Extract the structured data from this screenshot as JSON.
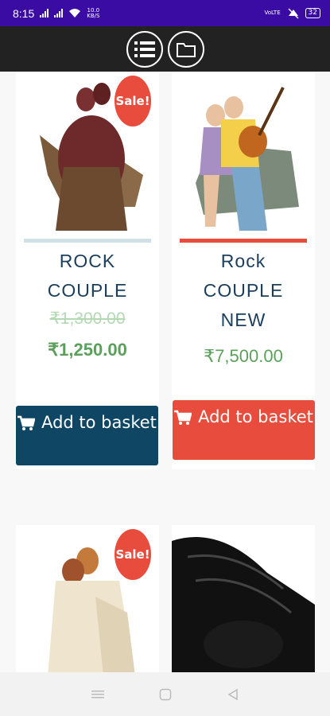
{
  "status_bar": {
    "time": "8:15",
    "speed": "10.0",
    "speed_unit": "KB/S",
    "volte": "VoLTE",
    "battery": "32"
  },
  "header": {
    "list_icon": "list-icon",
    "folder_icon": "folder-icon"
  },
  "products": [
    {
      "title": "ROCK COUPLE",
      "sale_badge": "Sale!",
      "old_price": "₹1,300.00",
      "price": "₹1,250.00",
      "button_label": "Add to basket"
    },
    {
      "title": "Rock COUPLE NEW",
      "price": "₹7,500.00",
      "button_label": "Add to basket"
    },
    {
      "sale_badge": "Sale!"
    },
    {}
  ],
  "nav_bar": {
    "menu_icon": "menu-icon",
    "home_icon": "home-icon",
    "back_icon": "back-icon"
  },
  "colors": {
    "status_bar": "#3a0ca3",
    "header": "#222222",
    "sale": "#e74c3c",
    "button_dark": "#0e4663",
    "button_red": "#e74c3c",
    "price": "#5aa05a",
    "title": "#1a3e5c"
  }
}
